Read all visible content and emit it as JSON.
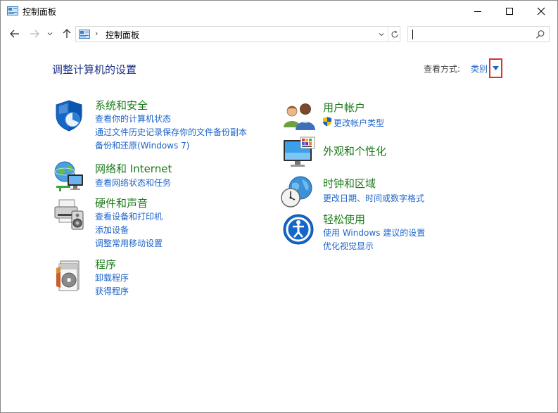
{
  "window": {
    "title": "控制面板"
  },
  "address": {
    "separator": "›",
    "path": "控制面板"
  },
  "search": {
    "value": ""
  },
  "content": {
    "heading": "调整计算机的设置",
    "view_by_label": "查看方式:",
    "view_by_value": "类别"
  },
  "categories": [
    {
      "title": "系统和安全",
      "icon": "system-security-icon",
      "links": [
        "查看你的计算机状态",
        "通过文件历史记录保存你的文件备份副本",
        "备份和还原(Windows 7)"
      ]
    },
    {
      "title": "网络和 Internet",
      "icon": "network-internet-icon",
      "links": [
        "查看网络状态和任务"
      ]
    },
    {
      "title": "硬件和声音",
      "icon": "hardware-sound-icon",
      "links": [
        "查看设备和打印机",
        "添加设备",
        "调整常用移动设置"
      ]
    },
    {
      "title": "程序",
      "icon": "programs-icon",
      "links": [
        "卸载程序",
        "获得程序"
      ]
    },
    {
      "title": "用户帐户",
      "icon": "user-accounts-icon",
      "links": [
        "更改帐户类型"
      ]
    },
    {
      "title": "外观和个性化",
      "icon": "appearance-icon",
      "links": []
    },
    {
      "title": "时钟和区域",
      "icon": "clock-region-icon",
      "links": [
        "更改日期、时间或数字格式"
      ]
    },
    {
      "title": "轻松使用",
      "icon": "ease-of-access-icon",
      "links": [
        "使用 Windows 建议的设置",
        "优化视觉显示"
      ]
    }
  ],
  "colors": {
    "category_title": "#1b7a1b",
    "link": "#1e64c8",
    "heading": "#1e3287",
    "highlight_box": "#e03030"
  }
}
